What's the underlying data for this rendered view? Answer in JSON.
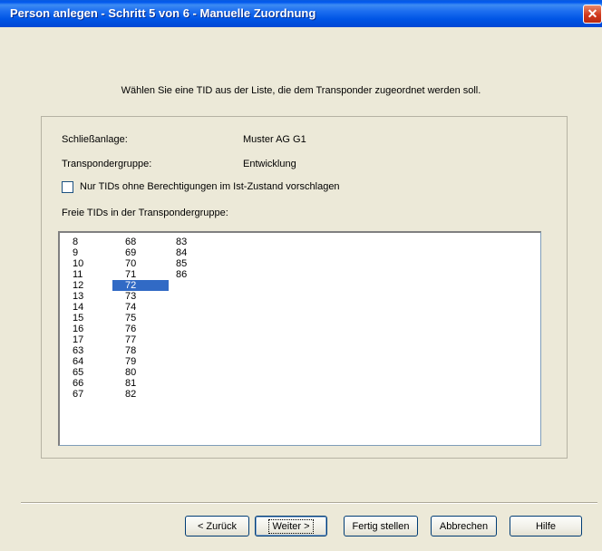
{
  "window": {
    "title": "Person anlegen - Schritt 5 von 6 - Manuelle Zuordnung",
    "close_symbol": "✕"
  },
  "instruction": "Wählen Sie eine TID aus der Liste, die dem Transponder zugeordnet werden soll.",
  "fields": {
    "schliessanlage_label": "Schließanlage:",
    "schliessanlage_value": "Muster AG G1",
    "transpondergruppe_label": "Transpondergruppe:",
    "transpondergruppe_value": "Entwicklung"
  },
  "checkbox": {
    "label": "Nur TIDs ohne Berechtigungen im Ist-Zustand vorschlagen",
    "checked": false
  },
  "list": {
    "label": "Freie TIDs in der Transpondergruppe:",
    "columns": [
      [
        "8",
        "9",
        "10",
        "11",
        "12",
        "13",
        "14",
        "15",
        "16",
        "17",
        "63",
        "64",
        "65",
        "66",
        "67"
      ],
      [
        "68",
        "69",
        "70",
        "71",
        "72",
        "73",
        "74",
        "75",
        "76",
        "77",
        "78",
        "79",
        "80",
        "81",
        "82"
      ],
      [
        "83",
        "84",
        "85",
        "86"
      ]
    ],
    "selected": "72"
  },
  "buttons": {
    "back": "< Zurück",
    "next": "Weiter >",
    "finish": "Fertig stellen",
    "cancel": "Abbrechen",
    "help": "Hilfe"
  },
  "colors": {
    "titlebar": "#0055e5",
    "selection": "#316ac5",
    "dialog_bg": "#ece9d8"
  }
}
